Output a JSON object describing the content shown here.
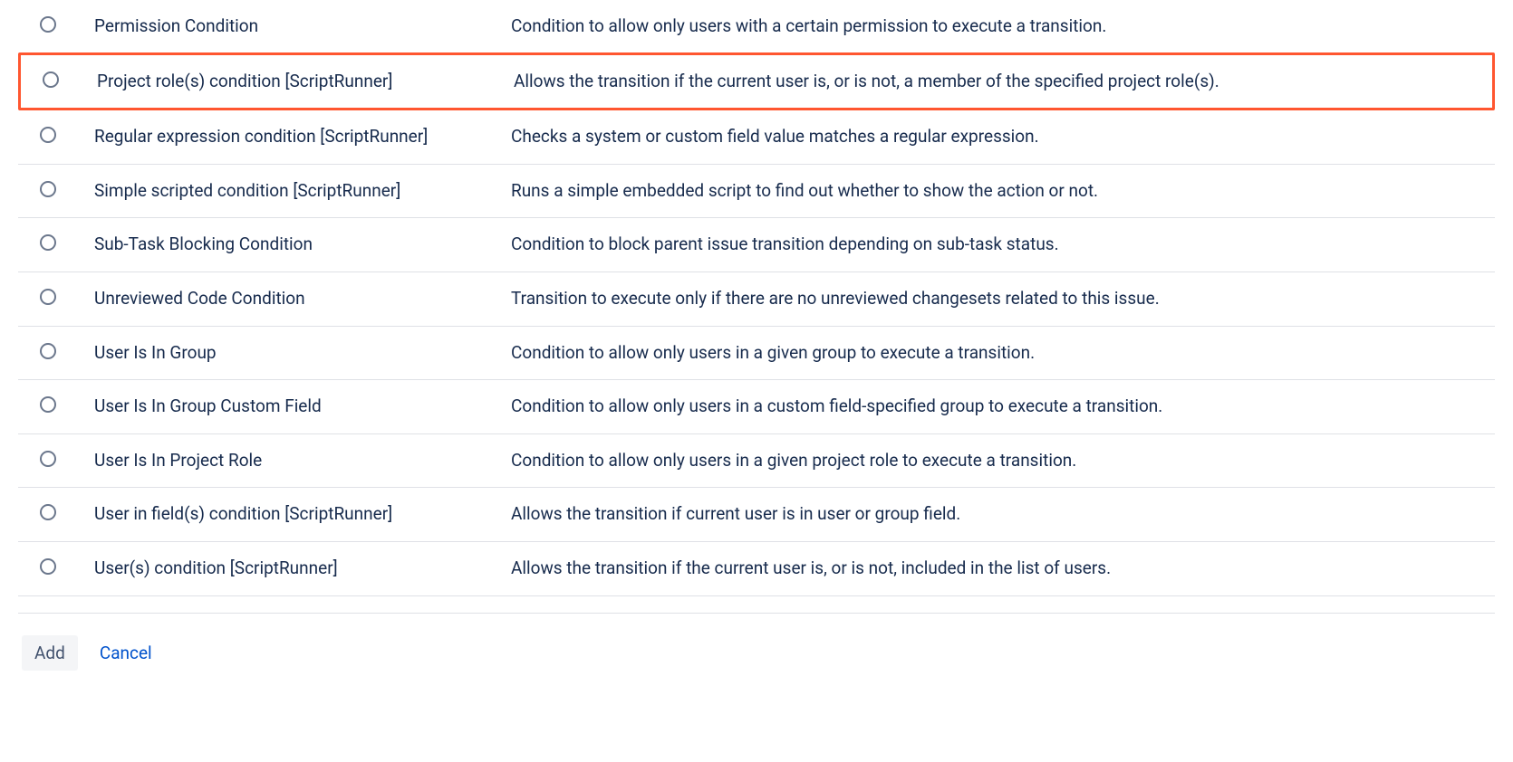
{
  "conditions": [
    {
      "name": "Permission Condition",
      "description": "Condition to allow only users with a certain permission to execute a transition.",
      "highlighted": false
    },
    {
      "name": "Project role(s) condition [ScriptRunner]",
      "description": "Allows the transition if the current user is, or is not, a member of the specified project role(s).",
      "highlighted": true
    },
    {
      "name": "Regular expression condition [ScriptRunner]",
      "description": "Checks a system or custom field value matches a regular expression.",
      "highlighted": false
    },
    {
      "name": "Simple scripted condition [ScriptRunner]",
      "description": "Runs a simple embedded script to find out whether to show the action or not.",
      "highlighted": false
    },
    {
      "name": "Sub-Task Blocking Condition",
      "description": "Condition to block parent issue transition depending on sub-task status.",
      "highlighted": false
    },
    {
      "name": "Unreviewed Code Condition",
      "description": "Transition to execute only if there are no unreviewed changesets related to this issue.",
      "highlighted": false
    },
    {
      "name": "User Is In Group",
      "description": "Condition to allow only users in a given group to execute a transition.",
      "highlighted": false
    },
    {
      "name": "User Is In Group Custom Field",
      "description": "Condition to allow only users in a custom field-specified group to execute a transition.",
      "highlighted": false
    },
    {
      "name": "User Is In Project Role",
      "description": "Condition to allow only users in a given project role to execute a transition.",
      "highlighted": false
    },
    {
      "name": "User in field(s) condition [ScriptRunner]",
      "description": "Allows the transition if current user is in user or group field.",
      "highlighted": false
    },
    {
      "name": "User(s) condition [ScriptRunner]",
      "description": "Allows the transition if the current user is, or is not, included in the list of users.",
      "highlighted": false
    }
  ],
  "footer": {
    "add_label": "Add",
    "cancel_label": "Cancel"
  }
}
